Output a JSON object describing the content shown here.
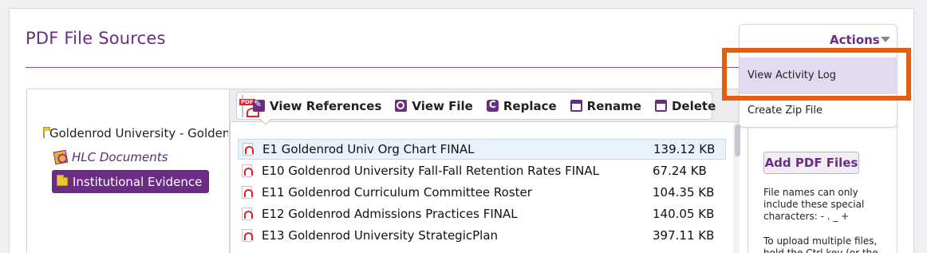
{
  "page": {
    "title": "PDF File Sources"
  },
  "tree": {
    "root_label": "Goldenrod University - Goldenrod",
    "items": [
      {
        "label": "HLC Documents"
      },
      {
        "label": "Institutional Evidence"
      }
    ]
  },
  "toolbar": {
    "view_references": "View References",
    "view_file": "View File",
    "replace": "Replace",
    "rename": "Rename",
    "delete": "Delete"
  },
  "files": [
    {
      "name": "E1 Goldenrod Univ Org Chart FINAL",
      "size": "139.12 KB"
    },
    {
      "name": "E10 Goldenrod University Fall-Fall Retention Rates FINAL",
      "size": "67.24 KB"
    },
    {
      "name": "E11 Goldenrod Curriculum Committee Roster",
      "size": "104.35 KB"
    },
    {
      "name": "E12 Goldenrod Admissions Practices FINAL",
      "size": "140.05 KB"
    },
    {
      "name": "E13 Goldenrod University StrategicPlan",
      "size": "397.11 KB"
    }
  ],
  "actions": {
    "label": "Actions",
    "menu": [
      {
        "label": "View Activity Log"
      },
      {
        "label": "Create Zip File"
      }
    ]
  },
  "upload": {
    "add_button": "Add PDF Files",
    "help_special_chars": "File names can only include these special characters: - . _ +",
    "help_multiple": "To upload multiple files, hold the Ctrl key (or the"
  },
  "colors": {
    "brand": "#6b2c86",
    "highlight": "#e25f10",
    "menu_hover": "#e2daf0"
  }
}
